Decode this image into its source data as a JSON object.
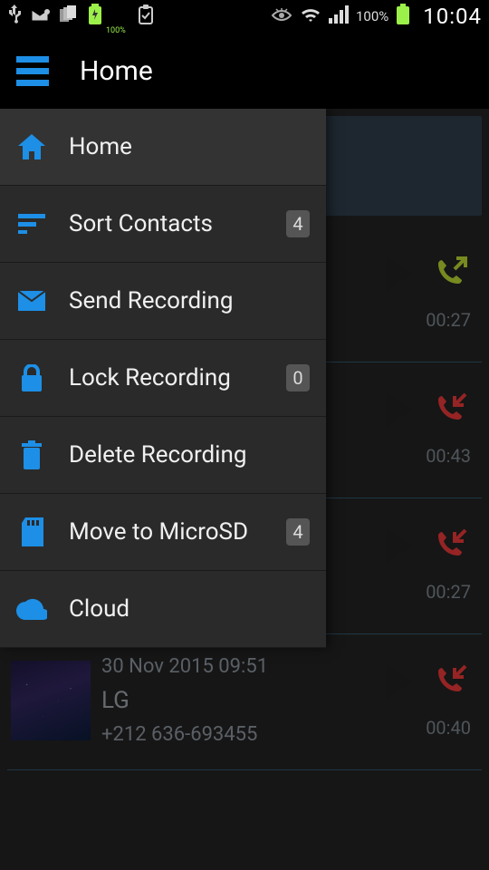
{
  "statusbar": {
    "battery_pct": "100%",
    "clock": "10:04"
  },
  "appbar": {
    "title": "Home"
  },
  "drawer": {
    "items": [
      {
        "label": "Home",
        "icon": "home-icon",
        "badge": null
      },
      {
        "label": "Sort Contacts",
        "icon": "sort-icon",
        "badge": "4"
      },
      {
        "label": "Send Recording",
        "icon": "mail-icon",
        "badge": null
      },
      {
        "label": "Lock Recording",
        "icon": "lock-icon",
        "badge": "0"
      },
      {
        "label": "Delete Recording",
        "icon": "trash-icon",
        "badge": null
      },
      {
        "label": "Move to MicroSD",
        "icon": "sdcard-icon",
        "badge": "4"
      },
      {
        "label": "Cloud",
        "icon": "cloud-icon",
        "badge": null
      }
    ]
  },
  "recordings": [
    {
      "date": "",
      "name": "",
      "number": "",
      "duration": "00:27",
      "direction": "outgoing"
    },
    {
      "date": "",
      "name": "",
      "number": "",
      "duration": "00:43",
      "direction": "incoming"
    },
    {
      "date": "",
      "name": "",
      "number": "",
      "duration": "00:27",
      "direction": "incoming"
    },
    {
      "date": "30 Nov 2015  09:51",
      "name": "LG",
      "number": "+212 636-693455",
      "duration": "00:40",
      "direction": "incoming"
    }
  ],
  "colors": {
    "accent": "#1d8fe6",
    "outgoing": "#9fb82b",
    "incoming": "#c83030"
  }
}
